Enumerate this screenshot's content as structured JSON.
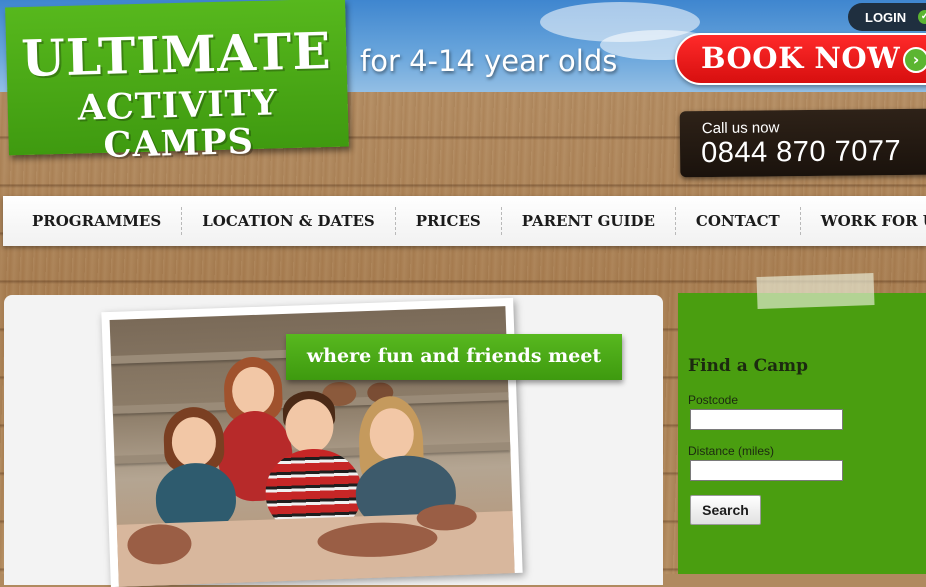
{
  "header": {
    "logo_line1": "ULTIMATE",
    "logo_line2": "ACTIVITY CAMPS",
    "tagline": "for 4-14 year olds",
    "login_label": "LOGIN",
    "book_label": "BOOK NOW",
    "call_label": "Call us now",
    "phone": "0844 870 7077"
  },
  "nav": {
    "items": [
      "PROGRAMMES",
      "LOCATION & DATES",
      "PRICES",
      "PARENT GUIDE",
      "CONTACT",
      "WORK FOR US"
    ]
  },
  "hero": {
    "banner": "where fun and friends meet"
  },
  "find_camp": {
    "title": "Find a Camp",
    "postcode_label": "Postcode",
    "postcode_value": "",
    "distance_label": "Distance (miles)",
    "distance_value": "",
    "search_label": "Search"
  },
  "colors": {
    "brand_green": "#4a9e10",
    "book_red": "#e01414",
    "dark_navy": "#1f2f3f"
  },
  "icons": {
    "login": "check-icon",
    "book": "chevron-right-icon"
  }
}
